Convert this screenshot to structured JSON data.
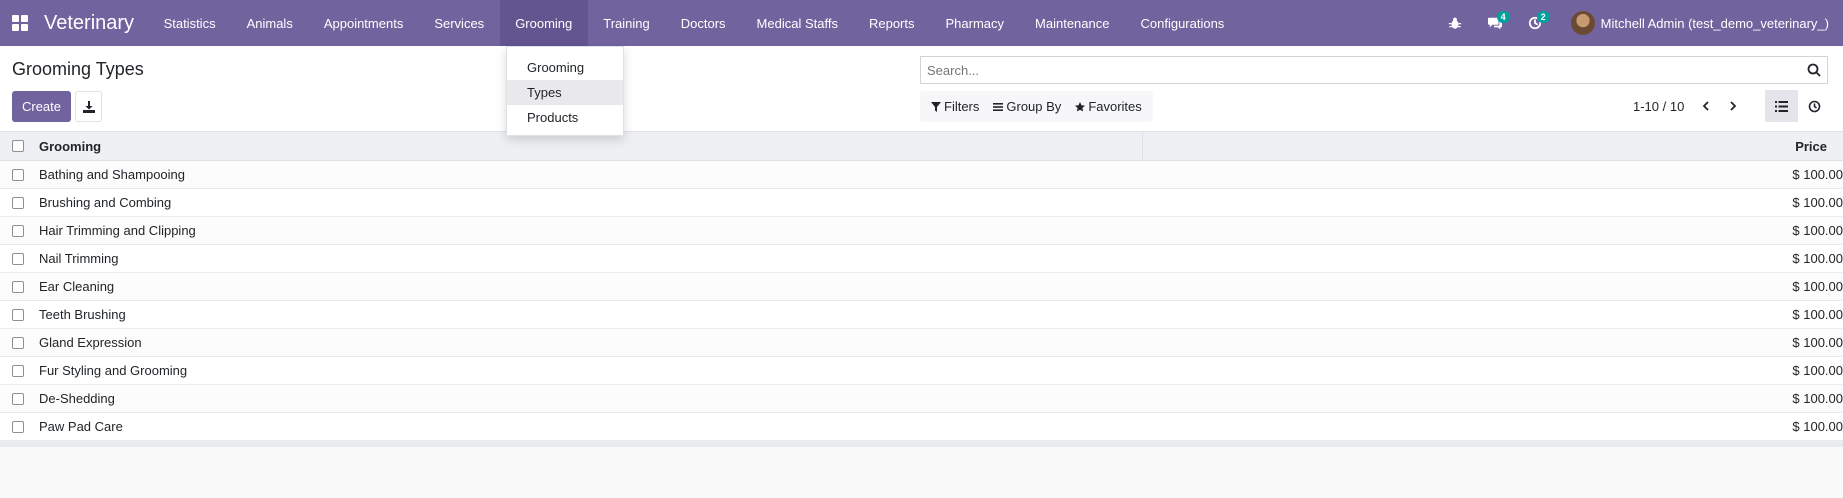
{
  "navbar": {
    "brand": "Veterinary",
    "menu": [
      {
        "label": "Statistics"
      },
      {
        "label": "Animals"
      },
      {
        "label": "Appointments"
      },
      {
        "label": "Services"
      },
      {
        "label": "Grooming",
        "active": true
      },
      {
        "label": "Training"
      },
      {
        "label": "Doctors"
      },
      {
        "label": "Medical Staffs"
      },
      {
        "label": "Reports"
      },
      {
        "label": "Pharmacy"
      },
      {
        "label": "Maintenance"
      },
      {
        "label": "Configurations"
      }
    ],
    "messages_count": "4",
    "activities_count": "2",
    "user_name": "Mitchell Admin (test_demo_veterinary_)",
    "color": "#71639e"
  },
  "dropdown": {
    "items": [
      {
        "label": "Grooming"
      },
      {
        "label": "Types"
      },
      {
        "label": "Products"
      }
    ]
  },
  "control_panel": {
    "title": "Grooming Types",
    "create_label": "Create",
    "search_placeholder": "Search...",
    "filters_label": "Filters",
    "group_by_label": "Group By",
    "favorites_label": "Favorites",
    "pager": "1-10 / 10"
  },
  "table": {
    "columns": [
      "Grooming",
      "Price"
    ],
    "rows": [
      {
        "name": "Bathing and Shampooing",
        "price": "$ 100.00"
      },
      {
        "name": "Brushing and Combing",
        "price": "$ 100.00"
      },
      {
        "name": "Hair Trimming and Clipping",
        "price": "$ 100.00"
      },
      {
        "name": "Nail Trimming",
        "price": "$ 100.00"
      },
      {
        "name": "Ear Cleaning",
        "price": "$ 100.00"
      },
      {
        "name": "Teeth Brushing",
        "price": "$ 100.00"
      },
      {
        "name": "Gland Expression",
        "price": "$ 100.00"
      },
      {
        "name": "Fur Styling and Grooming",
        "price": "$ 100.00"
      },
      {
        "name": "De-Shedding",
        "price": "$ 100.00"
      },
      {
        "name": "Paw Pad Care",
        "price": "$ 100.00"
      }
    ]
  }
}
